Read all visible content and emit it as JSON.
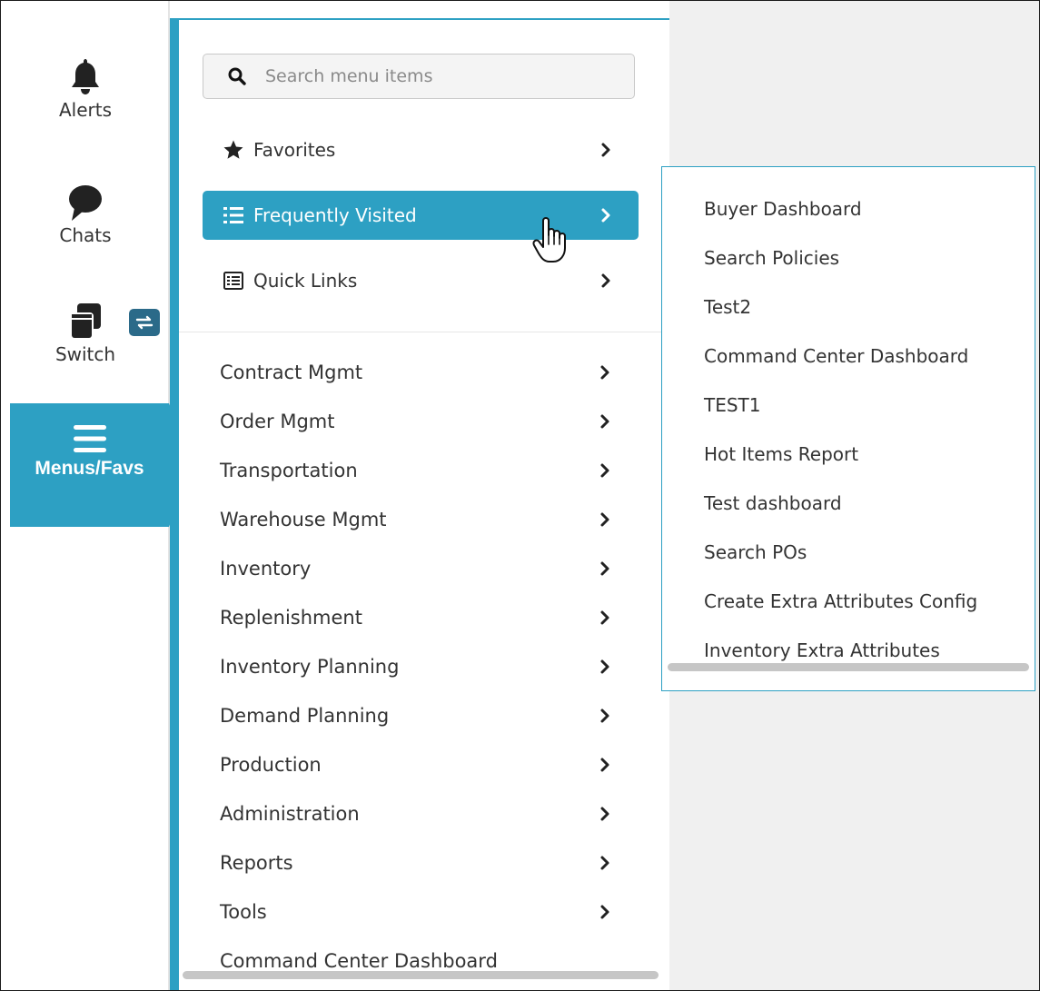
{
  "rail": {
    "alerts_label": "Alerts",
    "chats_label": "Chats",
    "switch_label": "Switch",
    "menus_label": "Menus/Favs"
  },
  "search": {
    "placeholder": "Search menu items",
    "value": ""
  },
  "top_items": {
    "favorites": "Favorites",
    "frequently_visited": "Frequently Visited",
    "quick_links": "Quick Links"
  },
  "menu_items": [
    "Contract Mgmt",
    "Order Mgmt",
    "Transportation",
    "Warehouse Mgmt",
    "Inventory",
    "Replenishment",
    "Inventory Planning",
    "Demand Planning",
    "Production",
    "Administration",
    "Reports",
    "Tools",
    "Command Center Dashboard"
  ],
  "flyout_items": [
    "Buyer Dashboard",
    "Search Policies",
    "Test2",
    "Command Center Dashboard",
    "TEST1",
    "Hot Items Report",
    "Test dashboard",
    "Search POs",
    "Create Extra Attributes Config",
    "Inventory Extra Attributes"
  ],
  "colors": {
    "accent": "#2da0c3",
    "switch_badge": "#2b6a89",
    "text": "#333333",
    "background_gray": "#f0f0f0"
  },
  "icons": {
    "alerts": "bell-icon",
    "chats": "chat-bubble-icon",
    "switch": "copy-windows-icon",
    "switch_badge": "swap-arrows-icon",
    "menus": "hamburger-icon",
    "search": "search-icon",
    "favorites": "star-icon",
    "frequently_visited": "list-icon",
    "quick_links": "list-box-icon",
    "chevron": "chevron-right-icon",
    "cursor": "hand-pointer-icon"
  }
}
